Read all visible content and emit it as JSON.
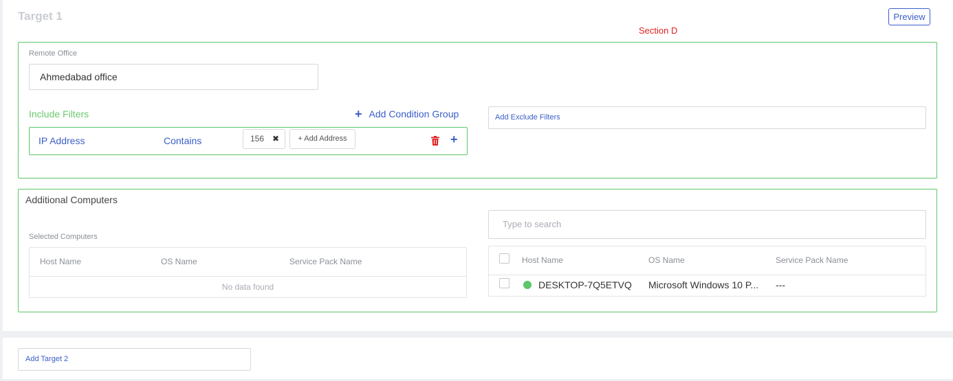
{
  "target": {
    "title": "Target 1",
    "preview_label": "Preview",
    "section_label": "Section D"
  },
  "remote_office": {
    "label": "Remote Office",
    "value": "Ahmedabad office"
  },
  "include_filters": {
    "label": "Include Filters",
    "add_condition_group_label": "Add Condition Group",
    "rows": [
      {
        "field": "IP Address",
        "operator": "Contains",
        "values": [
          "156"
        ],
        "add_address_label": "+ Add Address"
      }
    ]
  },
  "exclude_filters": {
    "placeholder": "Add Exclude Filters"
  },
  "additional_computers": {
    "title": "Additional Computers",
    "selected_label": "Selected Computers",
    "selected_columns": [
      "Host Name",
      "OS Name",
      "Service Pack Name"
    ],
    "selected_empty_text": "No data found",
    "search_placeholder": "Type to search",
    "available_columns": [
      "Host Name",
      "OS Name",
      "Service Pack Name"
    ],
    "available_rows": [
      {
        "status_color": "#5cc669",
        "host_name": "DESKTOP-7Q5ETVQ",
        "os_name": "Microsoft Windows 10 P...",
        "service_pack": "---"
      }
    ]
  },
  "add_target": {
    "placeholder": "Add Target 2"
  },
  "colors": {
    "accent_blue": "#3b5ec8",
    "green_border": "#5cc669",
    "danger_red": "#e02020"
  }
}
